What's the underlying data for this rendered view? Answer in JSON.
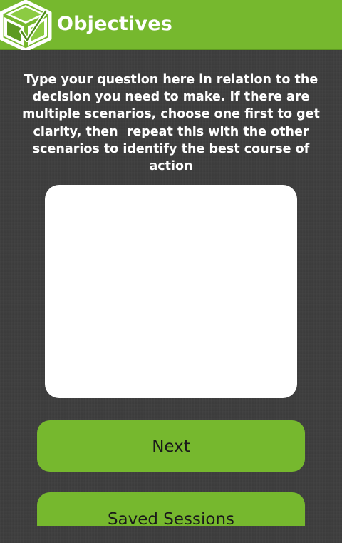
{
  "header": {
    "title": "Objectives",
    "logo_icon": "green-cube-logo-icon",
    "background_color": "#76b82e"
  },
  "main": {
    "instructions": "Type your question here in relation to the decision you need to make. If there are multiple scenarios, choose one first to get clarity, then  repeat this with the other scenarios to identify the best course of action",
    "question_input": {
      "value": "",
      "placeholder": ""
    },
    "buttons": {
      "next_label": "Next",
      "saved_sessions_label": "Saved Sessions"
    }
  },
  "colors": {
    "accent": "#76b82e",
    "background": "#3e3e3e",
    "text_light": "#ffffff",
    "text_dark": "#1a1a1a"
  }
}
